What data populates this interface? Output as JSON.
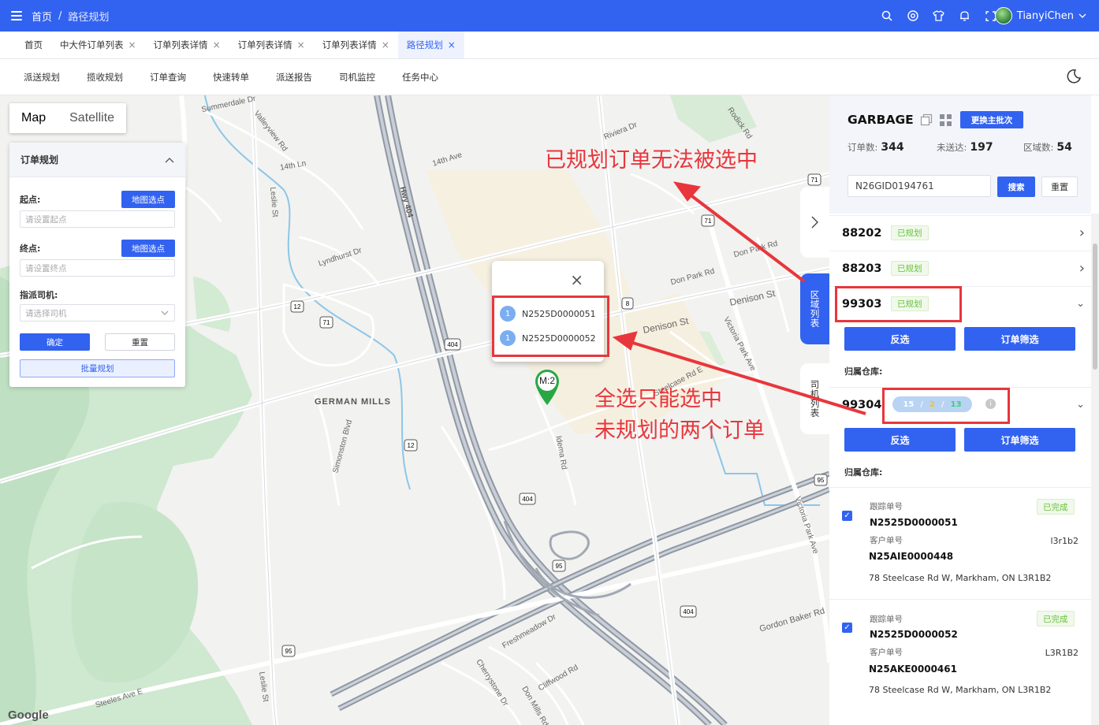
{
  "header": {
    "breadcrumb": [
      "首页",
      "路径规划"
    ],
    "breadcrumb_sep": "/",
    "user_name": "TianyiChen",
    "icons": [
      "search-icon",
      "support-icon",
      "shirt-icon",
      "bell-icon",
      "fullscreen-icon"
    ]
  },
  "tabs": [
    {
      "label": "首页",
      "closable": false
    },
    {
      "label": "中大件订单列表",
      "closable": true
    },
    {
      "label": "订单列表详情",
      "closable": true
    },
    {
      "label": "订单列表详情",
      "closable": true
    },
    {
      "label": "订单列表详情",
      "closable": true
    },
    {
      "label": "路径规划",
      "closable": true,
      "active": true
    }
  ],
  "tab_close": "×",
  "submenu": [
    "派送规划",
    "揽收规划",
    "订单查询",
    "快速转单",
    "派送报告",
    "司机监控",
    "任务中心"
  ],
  "map": {
    "type_map": "Map",
    "type_satellite": "Satellite",
    "google": "Google",
    "labels": [
      "Summerdale Dr",
      "Valleyview Rd",
      "14th Ln",
      "Leslie St",
      "Hwy 404",
      "14th Ave",
      "Riviera Dr",
      "Rodick Rd",
      "Lyndhurst Dr",
      "Don Park Rd",
      "Denison St",
      "Victoria Park Ave",
      "GERMAN MILLS",
      "Simonston Blvd",
      "Steelcase Rd E",
      "Idema Rd",
      "Freshmeadow Dr",
      "Gordon Baker Rd",
      "Steeles Ave E",
      "Cherrystone Dr",
      "Cliffwood Rd",
      "Don Mills Rd",
      "Leslie St",
      "Victoria Park Ave",
      "Don Park Rd",
      "Denison St",
      "14th Ave",
      "Leslie St"
    ],
    "shields": [
      "71",
      "71",
      "12",
      "71",
      "404",
      "12",
      "404",
      "95",
      "404",
      "95",
      "95",
      "8"
    ]
  },
  "order_panel": {
    "title": "订单规划",
    "start_label": "起点:",
    "start_placeholder": "请设置起点",
    "end_label": "终点:",
    "end_placeholder": "请设置终点",
    "pick_btn": "地图选点",
    "driver_label": "指派司机:",
    "driver_placeholder": "请选择司机",
    "confirm": "确定",
    "reset": "重置",
    "batch": "批量规划"
  },
  "popup": {
    "close": "×",
    "items": [
      {
        "num": "1",
        "id": "N2525D0000051"
      },
      {
        "num": "1",
        "id": "N2525D0000052"
      }
    ],
    "marker_label": "M:2"
  },
  "side_tabs": {
    "collapse": "›",
    "region_list": "区\n域\n列\n表",
    "driver_list": "司\n机\n列\n表"
  },
  "right_panel": {
    "title": "GARBAGE",
    "switch_btn": "更换主批次",
    "stats": [
      {
        "label": "订单数:",
        "value": "344"
      },
      {
        "label": "未送达:",
        "value": "197"
      },
      {
        "label": "区域数:",
        "value": "54"
      }
    ],
    "search_value": "N26GID0194761",
    "search_btn": "搜索",
    "reset_btn": "重置",
    "regions": [
      {
        "id": "88202",
        "status": "已规划",
        "chev": "›"
      },
      {
        "id": "88203",
        "status": "已规划",
        "chev": "›"
      },
      {
        "id": "99303",
        "status": "已规划",
        "chev": "⌄"
      },
      {
        "id": "99304",
        "chev": "⌄"
      }
    ],
    "invert_btn": "反选",
    "filter_btn": "订单筛选",
    "warehouse_label": "归属仓库:",
    "counts": [
      "15",
      "2",
      "13"
    ],
    "count_sep": "/",
    "count_colors": [
      "#ffffff",
      "#f2c230",
      "#3ad07a"
    ],
    "info": "i",
    "cards": [
      {
        "tracking_label": "跟踪单号",
        "tracking": "N2525D0000051",
        "customer_label": "客户单号",
        "customer": "N25AIE0000448",
        "zip": "l3r1b2",
        "status": "已完成",
        "address": "78 Steelcase Rd W, Markham, ON L3R1B2",
        "checked": true
      },
      {
        "tracking_label": "跟踪单号",
        "tracking": "N2525D0000052",
        "customer_label": "客户单号",
        "customer": "N25AKE0000461",
        "zip": "L3R1B2",
        "status": "已完成",
        "address": "78 Steelcase Rd W, Markham, ON L3R1B2",
        "checked": true
      }
    ],
    "check_mark": "✓"
  },
  "annotations": {
    "note_top": "已规划订单无法被选中",
    "note_bottom_1": "全选只能选中",
    "note_bottom_2": "未规划的两个订单",
    "color": "#e8363c"
  }
}
